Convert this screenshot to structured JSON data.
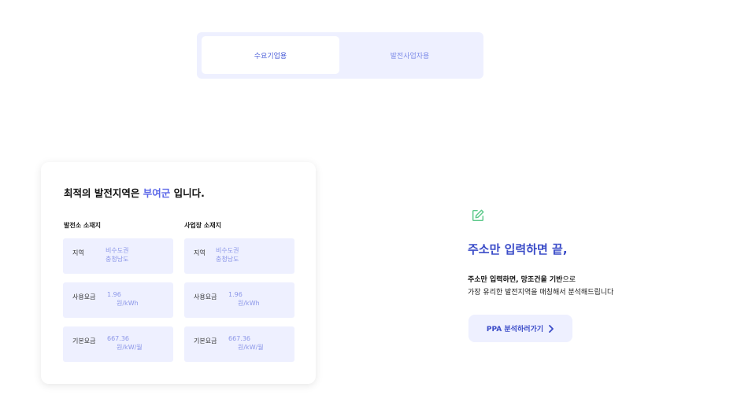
{
  "tabs": [
    {
      "label": "수요기업용",
      "active": true
    },
    {
      "label": "발전사업자용",
      "active": false
    }
  ],
  "card": {
    "title_prefix": "최적의 발전지역은 ",
    "title_highlight": "부여군",
    "title_suffix": " 입니다.",
    "columns": [
      {
        "heading": "발전소 소재지",
        "rows": [
          {
            "label": "지역",
            "value_line1": "비수도권",
            "value_line2": "충청남도"
          },
          {
            "label": "사용요금",
            "value_line1": "1.96",
            "value_line2": "원/kWh"
          },
          {
            "label": "기본요금",
            "value_line1": "667.36",
            "value_line2": "원/kW/월"
          }
        ]
      },
      {
        "heading": "사업장 소재지",
        "rows": [
          {
            "label": "지역",
            "value_line1": "비수도권",
            "value_line2": "충청남도"
          },
          {
            "label": "사용요금",
            "value_line1": "1.96",
            "value_line2": "원/kWh"
          },
          {
            "label": "기본요금",
            "value_line1": "667.36",
            "value_line2": "원/kW/월"
          }
        ]
      }
    ]
  },
  "promo": {
    "icon": "edit-icon",
    "headline": "주소만 입력하면 끝,",
    "desc1_bold": "주소만 입력하면, 망조건을 기반",
    "desc1_rest": "으로",
    "desc2": "가장 유리한 발전지역을 매칭해서 분석해드립니다",
    "cta_label": "PPA 분석하러가기",
    "cta_icon": "chevron-right-icon"
  },
  "colors": {
    "accent": "#3b4cc8",
    "highlight": "#5b67e8",
    "light_bg": "#eef0ff",
    "icon_green": "#5cc98a"
  }
}
